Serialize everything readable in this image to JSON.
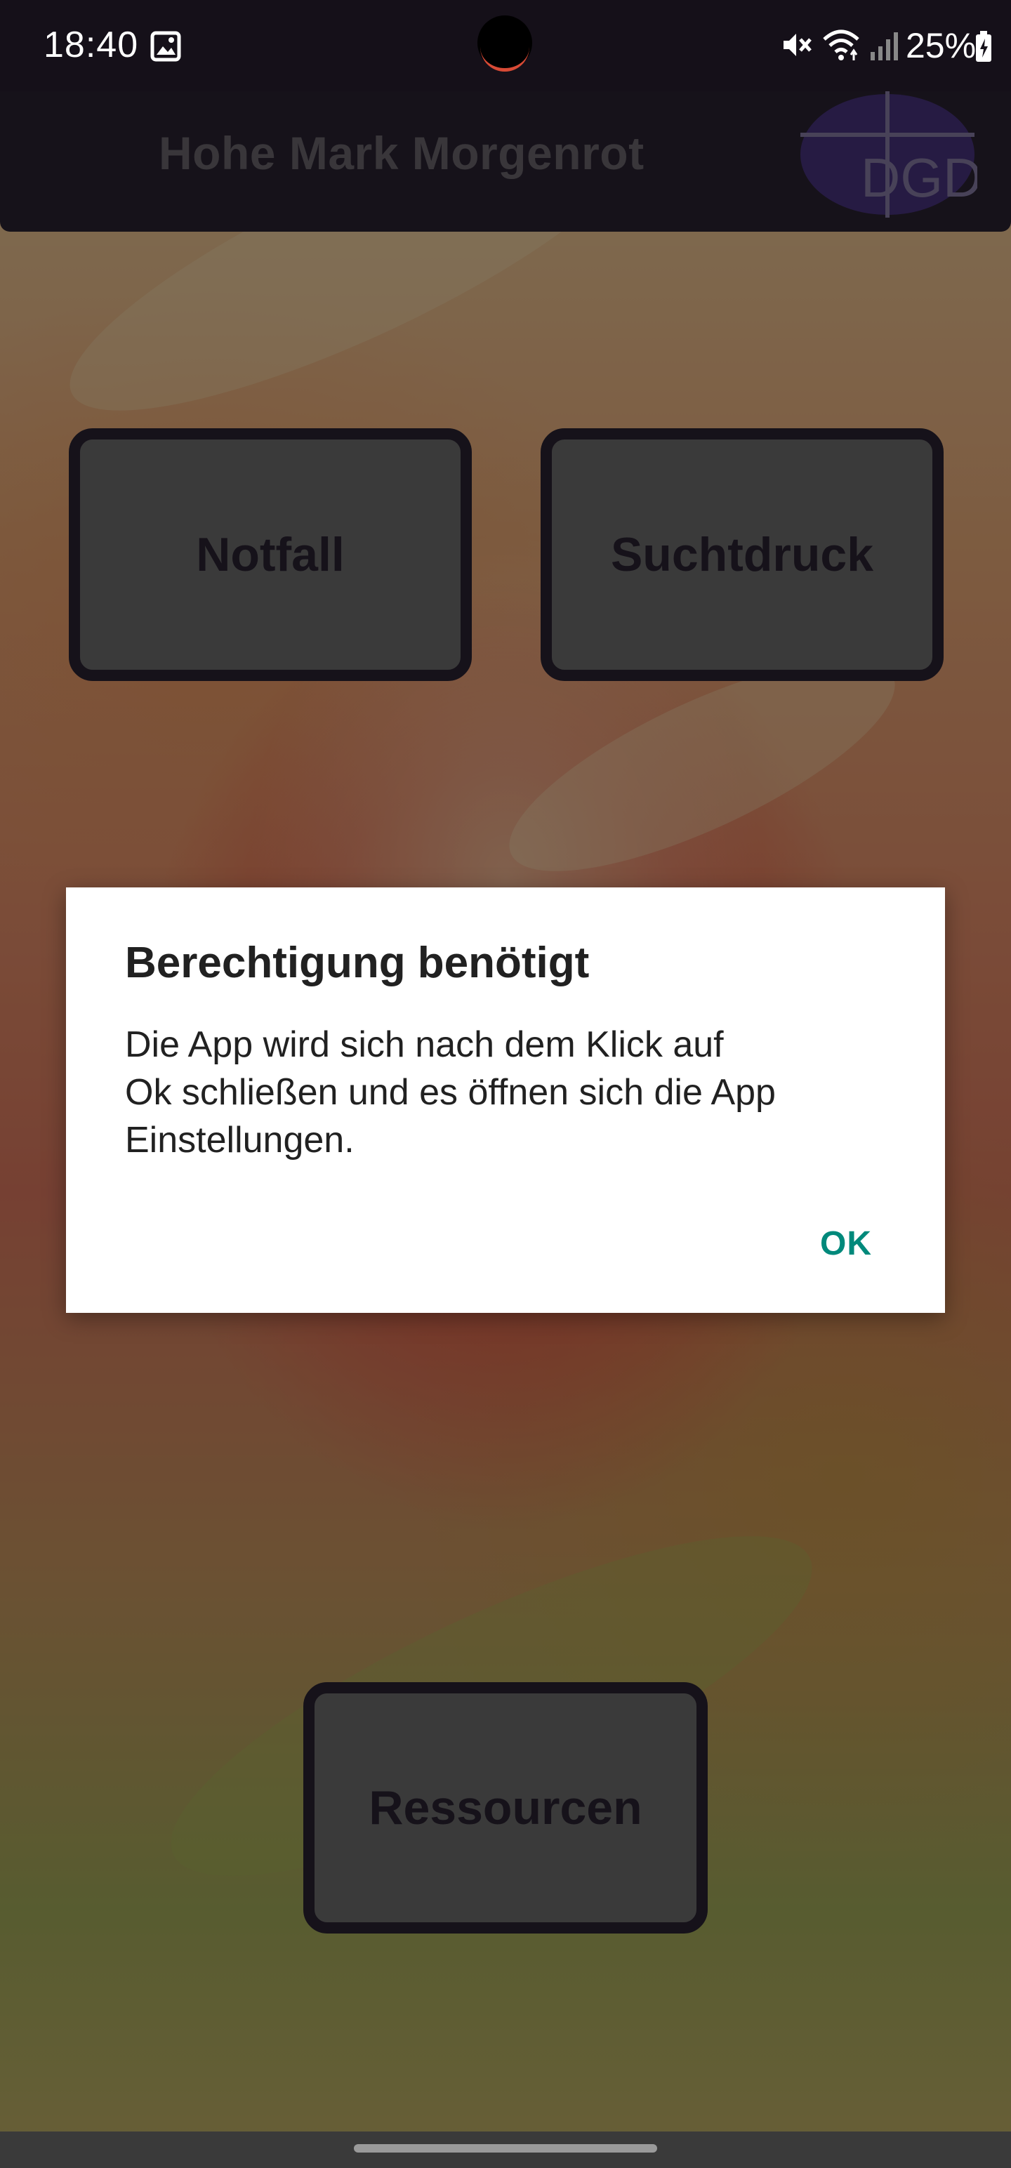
{
  "status_bar": {
    "time": "18:40",
    "battery_percent": "25%",
    "icons": [
      "gallery-icon",
      "mute-icon",
      "wifi-icon",
      "signal-icon",
      "battery-charging-icon"
    ]
  },
  "app_bar": {
    "title": "Hohe Mark Morgenrot",
    "logo_text": "DGD"
  },
  "buttons": {
    "notfall": "Notfall",
    "suchtdruck": "Suchtdruck",
    "ressourcen": "Ressourcen"
  },
  "dialog": {
    "title": "Berechtigung benötigt",
    "message": "Die App wird sich nach dem Klick auf\nOk schließen und es öffnen sich die App\nEinstellungen.",
    "ok_label": "OK"
  },
  "colors": {
    "app_bar": "#2b2333",
    "button_fill": "#707070",
    "button_border": "#2b2333",
    "dialog_accent": "#00897b"
  }
}
